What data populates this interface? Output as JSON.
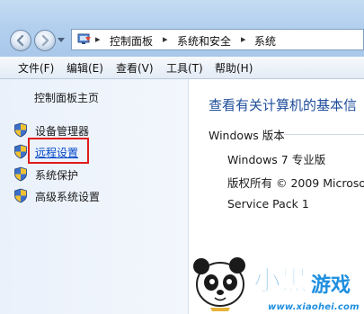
{
  "address_bar": {
    "breadcrumbs": [
      "控制面板",
      "系统和安全",
      "系统"
    ]
  },
  "menubar": {
    "items": [
      "文件(F)",
      "编辑(E)",
      "查看(V)",
      "工具(T)",
      "帮助(H)"
    ]
  },
  "left_pane": {
    "home_link": "控制面板主页",
    "tasks": [
      "设备管理器",
      "远程设置",
      "系统保护",
      "高级系统设置"
    ],
    "highlighted_task": "远程设置"
  },
  "main": {
    "title": "查看有关计算机的基本信",
    "section_header": "Windows 版本",
    "edition": "Windows 7 专业版",
    "copyright": "版权所有 © 2009 Microsof",
    "service_pack": "Service Pack 1"
  },
  "watermark": {
    "logo_text": "小黑游戏",
    "url": "www.xiaohei.com"
  },
  "colors": {
    "link": "#0046c7",
    "title": "#1e4d9b",
    "highlight_border": "#e01b1b",
    "watermark": "#1e8fe0"
  },
  "icons": {
    "back": "back-arrow-icon",
    "forward": "forward-arrow-icon",
    "address": "control-panel-icon",
    "task": "uac-shield-icon"
  }
}
